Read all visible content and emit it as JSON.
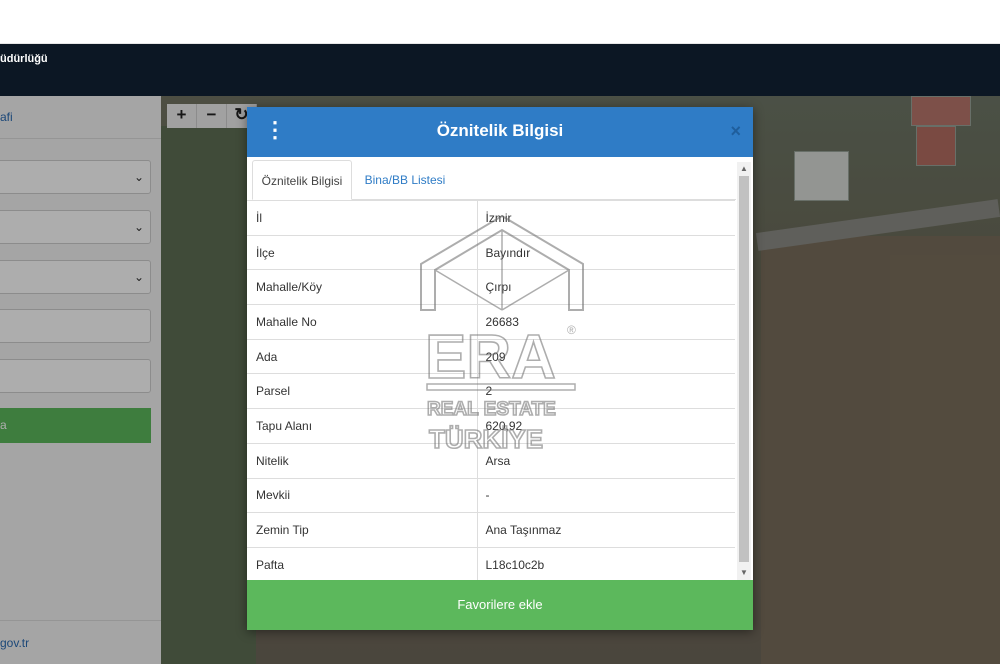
{
  "header": {
    "title": "üdürlüğü"
  },
  "sidebar": {
    "link": "afi",
    "action_button": "a",
    "footer_link": "gov.tr"
  },
  "map": {
    "controls": {
      "zoom_in": "+",
      "zoom_out": "−",
      "refresh": "↻"
    }
  },
  "modal": {
    "title": "Öznitelik Bilgisi",
    "close": "×",
    "tabs": [
      {
        "label": "Öznitelik Bilgisi",
        "active": true
      },
      {
        "label": "Bina/BB Listesi",
        "active": false
      }
    ],
    "rows": [
      {
        "key": "İl",
        "value": "İzmir"
      },
      {
        "key": "İlçe",
        "value": "Bayındır"
      },
      {
        "key": "Mahalle/Köy",
        "value": "Çırpı"
      },
      {
        "key": "Mahalle No",
        "value": "26683"
      },
      {
        "key": "Ada",
        "value": "209"
      },
      {
        "key": "Parsel",
        "value": "2"
      },
      {
        "key": "Tapu Alanı",
        "value": "620,92"
      },
      {
        "key": "Nitelik",
        "value": "Arsa"
      },
      {
        "key": "Mevkii",
        "value": "-"
      },
      {
        "key": "Zemin Tip",
        "value": "Ana Taşınmaz"
      },
      {
        "key": "Pafta",
        "value": "L18c10c2b"
      }
    ],
    "favorite_button": "Favorilere ekle"
  },
  "watermark": {
    "brand": "ERA",
    "line1": "REAL ESTATE",
    "line2": "TÜRKİYE",
    "registered": "®"
  },
  "colors": {
    "header_bg": "#0c1724",
    "modal_header": "#2f7cc6",
    "success_green": "#5cb85c",
    "link_blue": "#2a6ab2"
  }
}
